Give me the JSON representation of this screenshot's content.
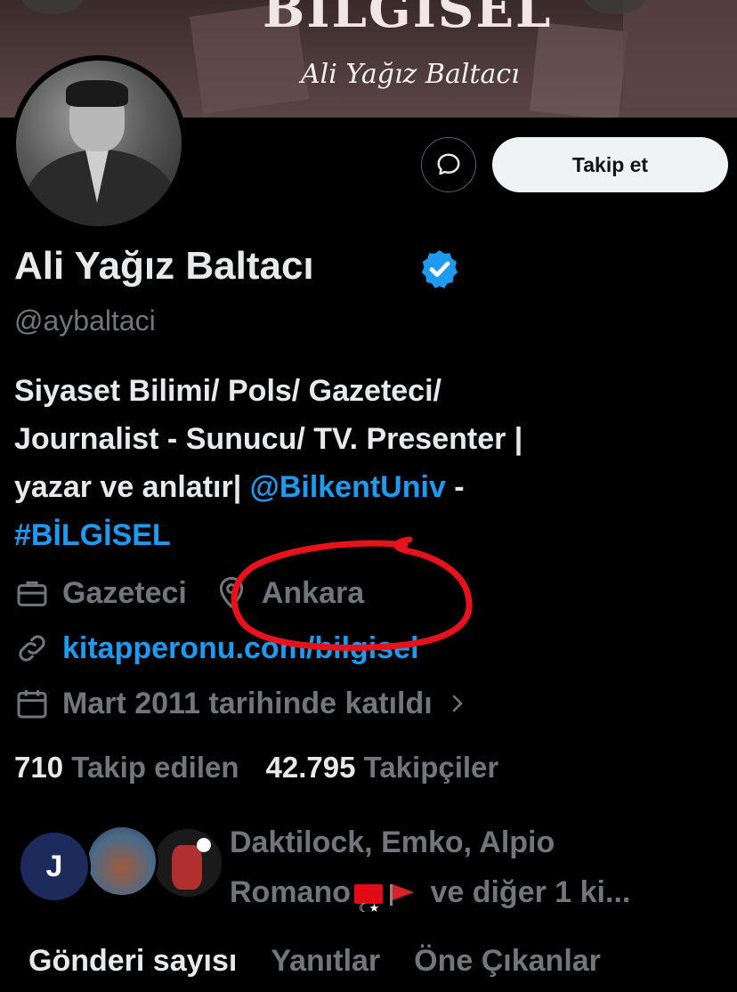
{
  "banner": {
    "title": "BİLGİSEL",
    "signature": "Ali Yağız Baltacı"
  },
  "profile": {
    "name": "Ali Yağız Baltacı",
    "handle": "@aybaltaci",
    "verified": true,
    "follow_label": "Takip et",
    "bio_lines": [
      "Siyaset Bilimi/ Pols/ Gazeteci/",
      "Journalist - Sunucu/ TV. Presenter |",
      "yazar ve anlatır| "
    ],
    "bio_mention": "@BilkentUniv",
    "bio_dash": " -",
    "bio_hashtag": "#BİLGİSEL",
    "profession": "Gazeteci",
    "location": "Ankara",
    "website": "kitapperonu.com/bilgisel",
    "joined": "Mart 2011 tarihinde katıldı",
    "following_count": "710",
    "following_label": "Takip edilen",
    "followers_count": "42.795",
    "followers_label": "Takipçiler"
  },
  "followed_by": {
    "line1": "Daktilock, Emko, Alpio",
    "line2_a": "Romano",
    "line2_b": "ve diğer 1 ki...",
    "avatar1_text": "J"
  },
  "tabs": [
    {
      "label": "Gönderi sayısı",
      "active": true
    },
    {
      "label": "Yanıtlar",
      "active": false
    },
    {
      "label": "Öne Çıkanlar",
      "active": false
    }
  ],
  "colors": {
    "accent": "#1d9bf0",
    "annotation": "#e8131a"
  }
}
